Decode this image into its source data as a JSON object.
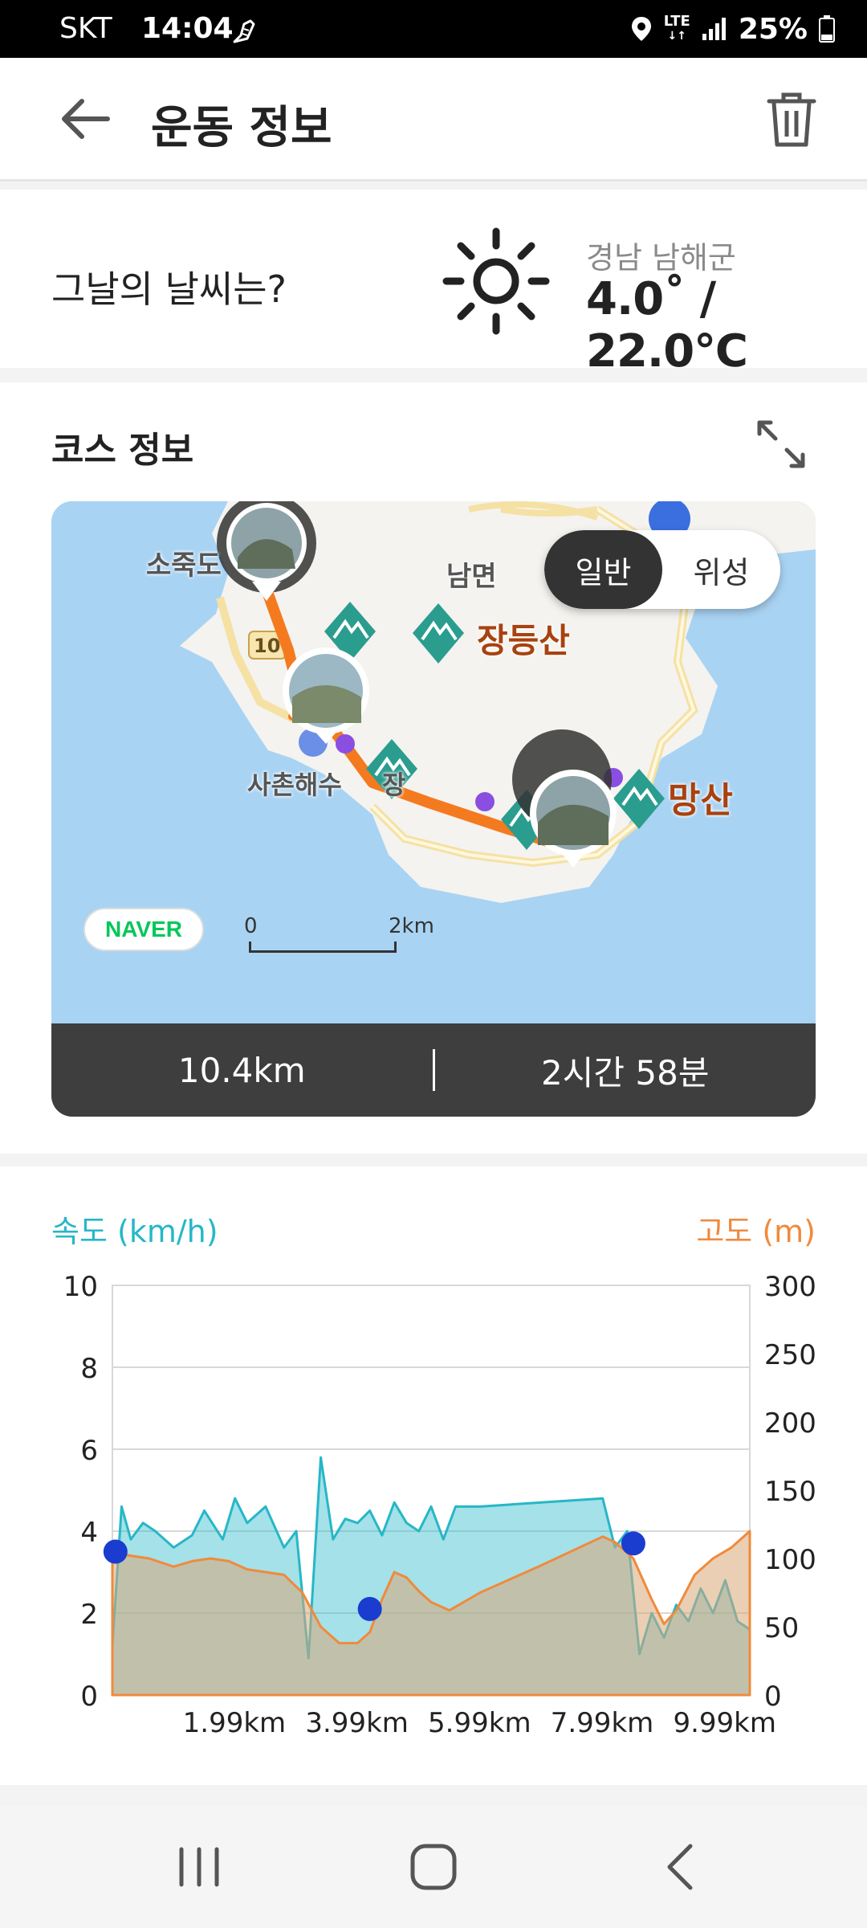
{
  "status_bar": {
    "carrier": "SKT",
    "time": "14:04",
    "network": "LTE",
    "battery": "25%",
    "icons": [
      "walking-shoe-icon",
      "location-icon",
      "lte-icon",
      "signal-icon",
      "battery-icon"
    ]
  },
  "header": {
    "title": "운동 정보",
    "back_icon": "arrow-left-icon",
    "delete_icon": "trash-icon"
  },
  "weather": {
    "question": "그날의 날씨는?",
    "icon": "sun-icon",
    "location": "경남 남해군",
    "temperature": "4.0˚ / 22.0℃"
  },
  "course": {
    "title": "코스 정보",
    "expand_icon": "expand-icon",
    "map_toggle": {
      "options": [
        "일반",
        "위성"
      ],
      "selected": "일반"
    },
    "map_provider": "NAVER",
    "scale": {
      "min": "0",
      "max": "2km"
    },
    "labels": {
      "town_1": "소죽도",
      "district": "남면",
      "mountain_1": "장등산",
      "beach": "사촌해수",
      "beach_suffix": "장",
      "mountain_2": "망산",
      "road_number": "10"
    },
    "distance": "10.4km",
    "duration": "2시간 58분",
    "route_color": "#f47a20"
  },
  "chart_data": {
    "type": "area",
    "speed_axis_label": "속도 (km/h)",
    "altitude_axis_label": "고도 (m)",
    "speed_ylim": [
      0,
      10
    ],
    "altitude_ylim": [
      0,
      300
    ],
    "speed_ticks": [
      "0",
      "2",
      "4",
      "6",
      "8",
      "10"
    ],
    "altitude_ticks": [
      "0",
      "50",
      "100",
      "150",
      "200",
      "250",
      "300"
    ],
    "x_ticks": [
      "1.99km",
      "3.99km",
      "5.99km",
      "7.99km",
      "9.99km"
    ],
    "xlim": [
      0,
      10.4
    ],
    "grid": true,
    "colors": {
      "speed": "#26b7c7",
      "altitude": "#f08a3c",
      "photo_marker": "#1a3ccf"
    },
    "series": [
      {
        "name": "속도 (km/h)",
        "axis": "left",
        "x": [
          0,
          0.15,
          0.3,
          0.5,
          0.7,
          1.0,
          1.3,
          1.5,
          1.8,
          2.0,
          2.2,
          2.5,
          2.8,
          3.0,
          3.2,
          3.4,
          3.6,
          3.8,
          4.0,
          4.2,
          4.4,
          4.6,
          4.8,
          5.0,
          5.2,
          5.4,
          5.5,
          5.6,
          6.0,
          7.0,
          8.0,
          8.2,
          8.4,
          8.6,
          8.8,
          9.0,
          9.2,
          9.4,
          9.6,
          9.8,
          10.0,
          10.2,
          10.4
        ],
        "values": [
          1.2,
          4.6,
          3.8,
          4.2,
          4.0,
          3.6,
          3.9,
          4.5,
          3.8,
          4.8,
          4.2,
          4.6,
          3.6,
          4.0,
          0.9,
          5.8,
          3.8,
          4.3,
          4.2,
          4.5,
          3.9,
          4.7,
          4.2,
          4.0,
          4.6,
          3.8,
          4.2,
          4.6,
          4.6,
          4.7,
          4.8,
          3.6,
          4.0,
          1.0,
          2.0,
          1.4,
          2.2,
          1.8,
          2.6,
          2.0,
          2.8,
          1.8,
          1.6
        ]
      },
      {
        "name": "고도 (m)",
        "axis": "right",
        "x": [
          0,
          0.3,
          0.6,
          1.0,
          1.3,
          1.6,
          1.9,
          2.2,
          2.5,
          2.8,
          3.1,
          3.4,
          3.7,
          4.0,
          4.2,
          4.4,
          4.6,
          4.8,
          5.0,
          5.2,
          5.5,
          6.0,
          7.0,
          8.0,
          8.2,
          8.5,
          8.8,
          9.0,
          9.2,
          9.5,
          9.8,
          10.1,
          10.4
        ],
        "values": [
          105,
          102,
          100,
          94,
          98,
          100,
          98,
          92,
          90,
          88,
          75,
          50,
          38,
          38,
          46,
          70,
          90,
          86,
          76,
          68,
          62,
          75,
          95,
          116,
          112,
          100,
          70,
          52,
          62,
          88,
          100,
          108,
          120
        ]
      }
    ],
    "photo_markers": [
      {
        "x": 0.05,
        "speed": 3.5
      },
      {
        "x": 4.2,
        "speed": 2.1
      },
      {
        "x": 8.5,
        "speed": 3.7
      }
    ]
  },
  "nav_bar": {
    "icons": [
      "recent-apps-icon",
      "home-icon",
      "back-icon"
    ]
  }
}
